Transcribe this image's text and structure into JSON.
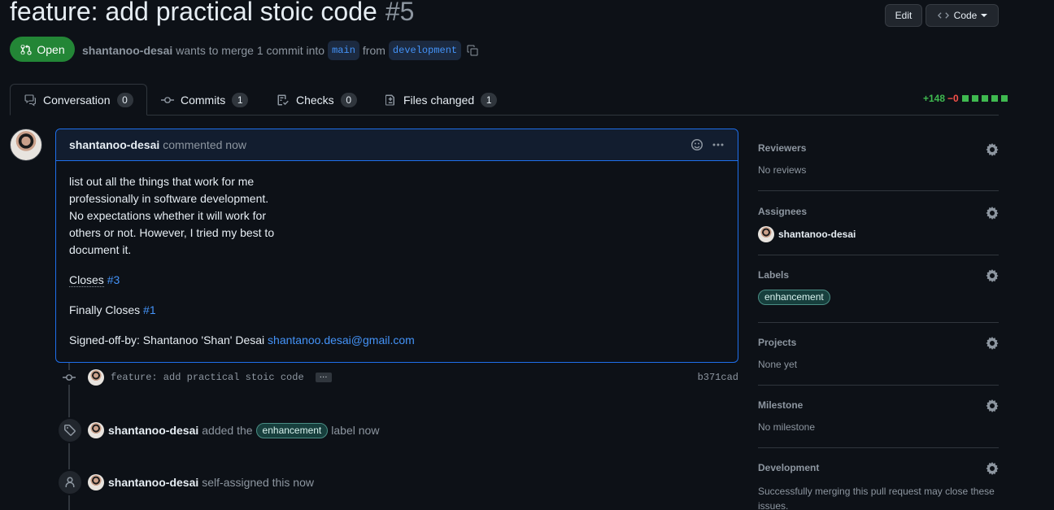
{
  "pr": {
    "title": "feature: add practical stoic code",
    "number": "#5",
    "state": "Open",
    "author": "shantanoo-desai",
    "merge_text": "wants to merge 1 commit into",
    "base_branch": "main",
    "from_text": "from",
    "head_branch": "development"
  },
  "header": {
    "edit_label": "Edit",
    "code_label": "Code"
  },
  "tabs": [
    {
      "label": "Conversation",
      "count": "0"
    },
    {
      "label": "Commits",
      "count": "1"
    },
    {
      "label": "Checks",
      "count": "0"
    },
    {
      "label": "Files changed",
      "count": "1"
    }
  ],
  "diffstat": {
    "additions": "+148",
    "deletions": "−0",
    "blocks": 5
  },
  "comment": {
    "author": "shantanoo-desai",
    "action": "commented now",
    "body_lines": [
      "list out all the things that work for me professionally in software development. No expectations whether it will work for others or not. However, I tried my best to document it."
    ],
    "closes_text": "Closes",
    "closes_ref": "#3",
    "finally_text": "Finally Closes",
    "finally_ref": "#1",
    "signoff_text": "Signed-off-by: Shantanoo 'Shan' Desai",
    "signoff_email": "shantanoo.desai@gmail.com"
  },
  "timeline": {
    "commit_msg": "feature: add practical stoic code",
    "commit_more": "···",
    "commit_sha": "b371cad",
    "label_event": {
      "author": "shantanoo-desai",
      "pre": "added the",
      "label": "enhancement",
      "post": "label now"
    },
    "assign_event": {
      "author": "shantanoo-desai",
      "text": "self-assigned this now"
    }
  },
  "sidebar": {
    "reviewers": {
      "title": "Reviewers",
      "value": "No reviews"
    },
    "assignees": {
      "title": "Assignees",
      "value": "shantanoo-desai"
    },
    "labels": {
      "title": "Labels",
      "value": "enhancement"
    },
    "projects": {
      "title": "Projects",
      "value": "None yet"
    },
    "milestone": {
      "title": "Milestone",
      "value": "No milestone"
    },
    "development": {
      "title": "Development",
      "value": "Successfully merging this pull request may close these issues."
    }
  },
  "colors": {
    "bg": "#0d1117",
    "accent": "#1f6feb",
    "open": "#238636",
    "label": "#173f3d"
  }
}
